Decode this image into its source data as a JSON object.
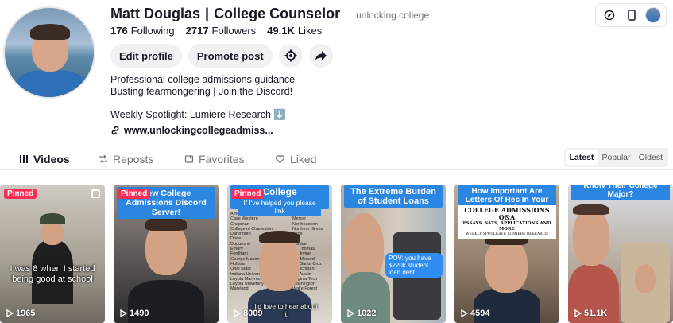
{
  "profile": {
    "name": "Matt Douglas",
    "separator": "|",
    "title": "College Counselor",
    "handle": "unlocking.college",
    "stats": {
      "following_count": "176",
      "following_label": "Following",
      "followers_count": "2717",
      "followers_label": "Followers",
      "likes_count": "49.1K",
      "likes_label": "Likes"
    },
    "buttons": {
      "edit": "Edit profile",
      "promote": "Promote post"
    },
    "bio_line1": "Professional college admissions guidance",
    "bio_line2": "Busting fearmongering | Join the Discord!",
    "spotlight": "Weekly Spotlight: Lumiere Research ⬇️",
    "link": "www.unlockingcollegeadmiss..."
  },
  "tabs": [
    {
      "label": "Videos",
      "icon": "grid-icon"
    },
    {
      "label": "Reposts",
      "icon": "repost-icon"
    },
    {
      "label": "Favorites",
      "icon": "bookmark-icon"
    },
    {
      "label": "Liked",
      "icon": "heart-icon"
    }
  ],
  "sort": {
    "latest": "Latest",
    "popular": "Popular",
    "oldest": "Oldest"
  },
  "videos": [
    {
      "pinned": "Pinned",
      "views": "1965",
      "overlay": "I was 8 when I started being good at school"
    },
    {
      "pinned": "Pinned",
      "views": "1490",
      "caption": "New College Admissions Discord Server!"
    },
    {
      "pinned": "Pinned",
      "views": "8009",
      "caption": "College Acceptances!",
      "subcaption": "If I've helped you please lmk",
      "bottom_text": "I'd love to hear about it.",
      "list_left": "American\nCase Western\nChapman\nCollege of Charleston\nDartmouth\nDrew\nDuquesne\nEmory\nFordham\nGeorge Mason\nHofstra\nOhio State\nIndiana University\nLoyola Marymount\nLoyola University\nMaryland",
      "list_right": "McDaniel\nMercer\nNortheastern\nNorthern Illinois\nPace\nPitt\nPurdue\nSt. Thomas\nUC Irvine\nUC Merced\nUC Santa Cruz\nU Michigan\nUT Austin\nVirginia Tech\nWashington\nWake Forest"
    },
    {
      "views": "1022",
      "caption": "The Extreme Burden of Student Loans",
      "pov": "POV: you have $220k student loan debt"
    },
    {
      "views": "4594",
      "caption": "How Important Are Letters Of Rec In Your Application?",
      "qa_title": "COLLEGE ADMISSIONS Q&A",
      "qa_sub": "ESSAYS, SATS, APPLICATIONS AND MORE",
      "qa_small": "WEEKLY SPOTLIGHT: LUMIERE RESEARCH"
    },
    {
      "views": "51.1K",
      "caption": "Know Their College Major?"
    }
  ]
}
